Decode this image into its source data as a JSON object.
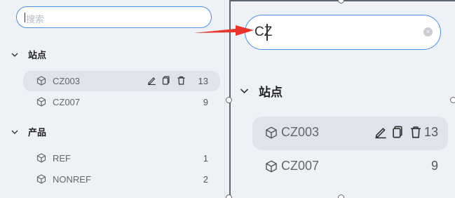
{
  "search": {
    "placeholder": "搜索",
    "zoom_value": "CZ"
  },
  "groups": [
    {
      "label": "站点",
      "items": [
        {
          "name": "CZ003",
          "count": "13"
        },
        {
          "name": "CZ007",
          "count": "9"
        }
      ]
    },
    {
      "label": "产品",
      "items": [
        {
          "name": "REF",
          "count": "1"
        },
        {
          "name": "NONREF",
          "count": "2"
        }
      ]
    }
  ],
  "zoom": {
    "group_label": "站点",
    "items": [
      {
        "name": "CZ003",
        "count": "13"
      },
      {
        "name": "CZ007",
        "count": "9"
      }
    ]
  },
  "colors": {
    "accent": "#4a8fe6",
    "arrow": "#e8352e",
    "selected_row": "#dfe4ec"
  },
  "icons": [
    "cube-icon",
    "edit-icon",
    "copy-icon",
    "delete-icon",
    "chevron-down-icon",
    "clear-icon"
  ]
}
